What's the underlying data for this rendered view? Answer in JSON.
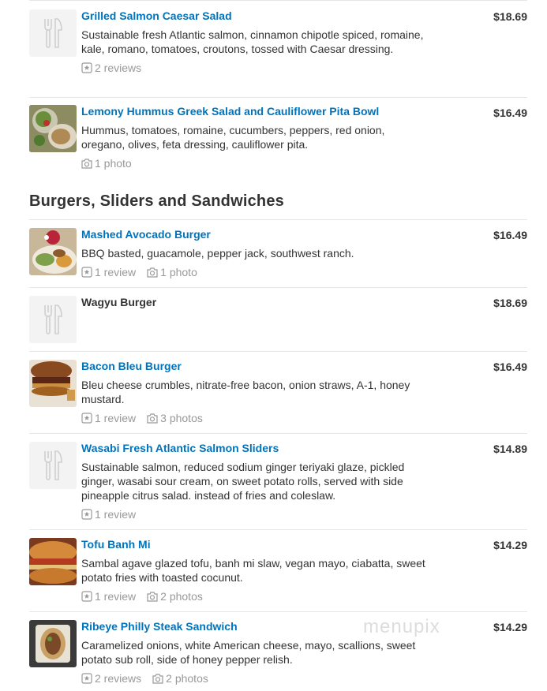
{
  "top_items": [
    {
      "name": "Grilled Salmon Caesar Salad",
      "price": "$18.69",
      "description": "Sustainable fresh Atlantic salmon, cinnamon chipotle spiced, romaine, kale, romano, tomatoes, croutons, tossed with Caesar dressing.",
      "reviews": "2 reviews",
      "photos": "",
      "thumb": "placeholder"
    },
    {
      "name": "Lemony Hummus Greek Salad and Cauliflower Pita Bowl",
      "price": "$16.49",
      "description": "Hummus, tomatoes, romaine, cucumbers, peppers, red onion, oregano, olives, feta dressing, cauliflower pita.",
      "reviews": "",
      "photos": "1 photo",
      "thumb": "salad-photo"
    }
  ],
  "section": {
    "title": "Burgers, Sliders and Sandwiches"
  },
  "items": [
    {
      "name": "Mashed Avocado Burger",
      "price": "$16.49",
      "description": "BBQ basted, guacamole, pepper jack, southwest ranch.",
      "reviews": "1 review",
      "photos": "1 photo",
      "thumb": "burger-plate-photo"
    },
    {
      "name": "Wagyu Burger",
      "price": "$18.69",
      "description": "",
      "reviews": "",
      "photos": "",
      "thumb": "placeholder"
    },
    {
      "name": "Bacon Bleu Burger",
      "price": "$16.49",
      "description": "Bleu cheese crumbles, nitrate-free bacon, onion straws, A-1, honey mustard.",
      "reviews": "1 review",
      "photos": "3 photos",
      "thumb": "burger-photo"
    },
    {
      "name": "Wasabi Fresh Atlantic Salmon Sliders",
      "price": "$14.89",
      "description": "Sustainable salmon, reduced sodium ginger teriyaki glaze, pickled ginger, wasabi sour cream, on sweet potato rolls, served with side pineapple citrus salad. instead of fries and coleslaw.",
      "reviews": "1 review",
      "photos": "",
      "thumb": "placeholder"
    },
    {
      "name": "Tofu Banh Mi",
      "price": "$14.29",
      "description": "Sambal agave glazed tofu, banh mi slaw, vegan mayo, ciabatta, sweet potato fries with toasted cocunut.",
      "reviews": "1 review",
      "photos": "2 photos",
      "thumb": "sandwich-photo"
    },
    {
      "name": "Ribeye Philly Steak Sandwich",
      "price": "$14.29",
      "description": "Caramelized onions, white American cheese, mayo, scallions, sweet potato sub roll, side of honey pepper relish.",
      "reviews": "2 reviews",
      "photos": "2 photos",
      "thumb": "steak-sandwich-photo"
    }
  ],
  "watermark": "menupix",
  "colors": {
    "link": "#0073bb",
    "text": "#333333",
    "muted": "#999999",
    "divider": "#e6e6e6"
  }
}
